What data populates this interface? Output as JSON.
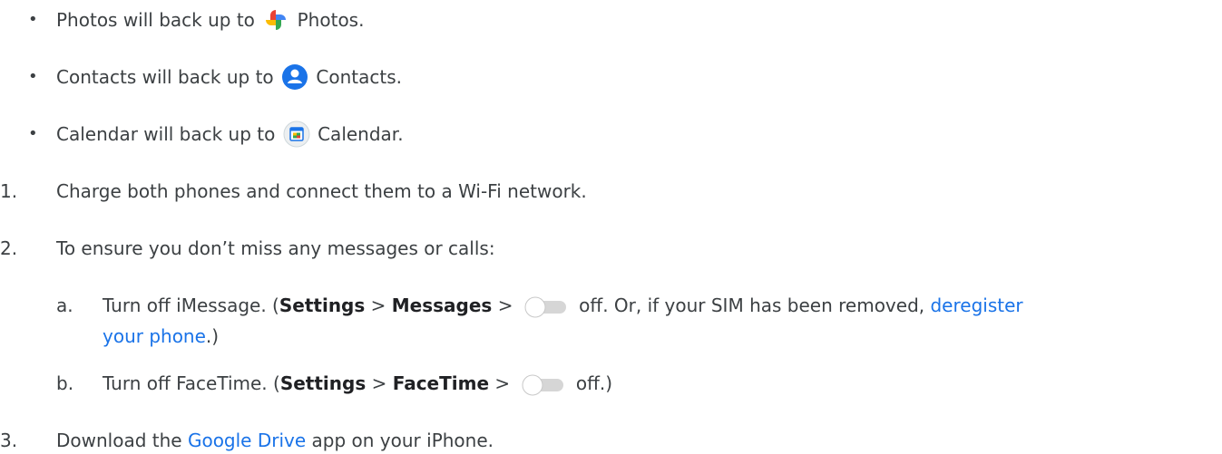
{
  "bullets": [
    {
      "text_before": "Photos will back up to",
      "app_name": "Photos",
      "suffix": ".",
      "icon": "google-photos-icon"
    },
    {
      "text_before": "Contacts will back up to",
      "app_name": "Contacts",
      "suffix": ".",
      "icon": "google-contacts-icon"
    },
    {
      "text_before": "Calendar will back up to",
      "app_name": "Calendar",
      "suffix": ".",
      "icon": "google-calendar-icon"
    }
  ],
  "steps": {
    "s1": {
      "num": "1.",
      "text": "Charge both phones and connect them to a Wi-Fi network."
    },
    "s2": {
      "num": "2.",
      "text": "To ensure you don’t miss any messages or calls:"
    },
    "s2a": {
      "letter": "a.",
      "before": "Turn off iMessage. (",
      "settings": "Settings",
      "sep": ">",
      "menu": "Messages",
      "after": "off. Or, if your SIM has been removed,",
      "link_part1": "deregister",
      "link_part2": "your phone",
      "end": ".)"
    },
    "s2b": {
      "letter": "b.",
      "before": "Turn off FaceTime. (",
      "settings": "Settings",
      "sep": ">",
      "menu": "FaceTime",
      "after": "off.)"
    },
    "s3": {
      "num": "3.",
      "before": "Download the",
      "link": "Google Drive",
      "after": "app on your iPhone."
    }
  },
  "colors": {
    "text": "#3c4043",
    "link": "#1a73e8"
  }
}
